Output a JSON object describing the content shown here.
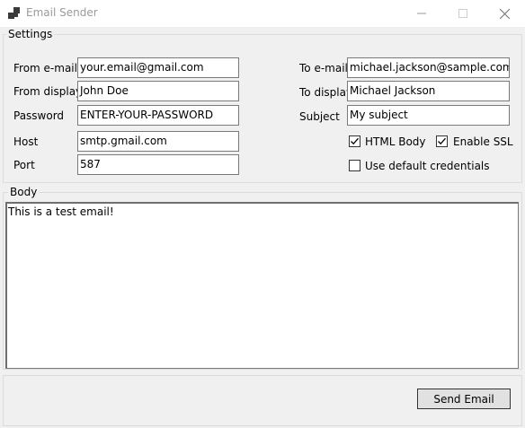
{
  "window": {
    "title": "Email Sender"
  },
  "settings": {
    "group_label": "Settings",
    "from_email": {
      "label": "From e-mail",
      "value": "your.email@gmail.com"
    },
    "from_display": {
      "label": "From display",
      "value": "John Doe"
    },
    "password": {
      "label": "Password",
      "value": "ENTER-YOUR-PASSWORD"
    },
    "host": {
      "label": "Host",
      "value": "smtp.gmail.com"
    },
    "port": {
      "label": "Port",
      "value": "587"
    },
    "to_email": {
      "label": "To e-mail",
      "value": "michael.jackson@sample.com"
    },
    "to_display": {
      "label": "To display",
      "value": "Michael Jackson"
    },
    "subject": {
      "label": "Subject",
      "value": "My subject"
    },
    "html_body": {
      "label": "HTML Body",
      "checked": true
    },
    "enable_ssl": {
      "label": "Enable SSL",
      "checked": true
    },
    "default_credentials": {
      "label": "Use default credentials",
      "checked": false
    }
  },
  "body": {
    "group_label": "Body",
    "text": "This is a test email!"
  },
  "actions": {
    "send_label": "Send Email"
  },
  "icons": {
    "app": "app-icon",
    "minimize": "minimize-icon",
    "maximize": "maximize-icon",
    "close": "close-icon",
    "check": "check-icon"
  },
  "colors": {
    "window_bg": "#f0f0f0",
    "titlebar_bg": "#ffffff",
    "border": "#7a7a7a"
  }
}
